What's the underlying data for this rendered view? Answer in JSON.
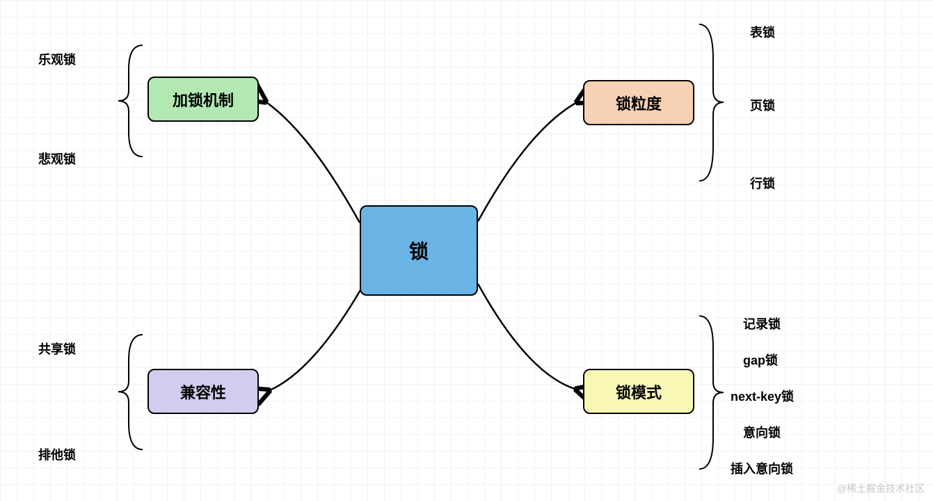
{
  "center": {
    "label": "锁"
  },
  "branches": {
    "tl": {
      "label": "加锁机制",
      "leaves": [
        "乐观锁",
        "悲观锁"
      ]
    },
    "bl": {
      "label": "兼容性",
      "leaves": [
        "共享锁",
        "排他锁"
      ]
    },
    "tr": {
      "label": "锁粒度",
      "leaves": [
        "表锁",
        "页锁",
        "行锁"
      ]
    },
    "br": {
      "label": "锁模式",
      "leaves": [
        "记录锁",
        "gap锁",
        "next-key锁",
        "意向锁",
        "插入意向锁"
      ]
    }
  },
  "watermark": "@稀土掘金技术社区"
}
